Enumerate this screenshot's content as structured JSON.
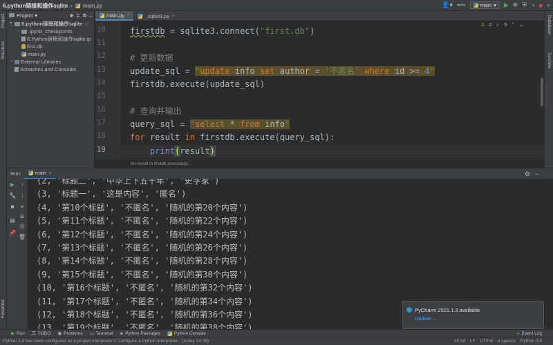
{
  "titlebar": {
    "project": "6.python链接和操作sqlite",
    "file": "main.py",
    "run_config": "main"
  },
  "sidebar_tabs": {
    "project": "Project",
    "structure": "Structure",
    "favorites": "Favorites"
  },
  "right_tabs": {
    "database": "Database",
    "sciview": "SciView"
  },
  "project_panel": {
    "header": "Project",
    "tree": [
      {
        "label": "6.python链接和操作sqlite",
        "suffix": "~/",
        "icon": "folder-icon",
        "indent": 0,
        "arrow": "▾"
      },
      {
        "label": ".ipynb_checkpoints",
        "icon": "folder-icon",
        "indent": 1,
        "arrow": "›"
      },
      {
        "label": "6.Python链接和操作sqlite.ip",
        "icon": "file-icon",
        "indent": 1,
        "arrow": ""
      },
      {
        "label": "first.db",
        "icon": "db-icon",
        "indent": 1,
        "arrow": ""
      },
      {
        "label": "main.py",
        "icon": "python-file-icon",
        "indent": 1,
        "arrow": ""
      },
      {
        "label": "External Libraries",
        "icon": "library-icon",
        "indent": 0,
        "arrow": "›"
      },
      {
        "label": "Scratches and Consoles",
        "icon": "scratch-icon",
        "indent": 0,
        "arrow": ""
      }
    ]
  },
  "editor_tabs": [
    {
      "label": "main.py",
      "active": true
    },
    {
      "label": "_sqlite3.py",
      "active": false
    }
  ],
  "inspection": {
    "warnings": "2",
    "weak": "5"
  },
  "code": {
    "line_numbers": [
      "10",
      "11",
      "12",
      "13",
      "14",
      "15",
      "16",
      "17",
      "18",
      "19"
    ],
    "l10": {
      "a": "firstdb",
      "b": " = sqlite3.connect(",
      "c": "\"first.db\"",
      "d": ")"
    },
    "l12": "# 更新数据",
    "l13": {
      "a": "update_sql = ",
      "q1": "\"",
      "kw1": "update",
      "t1": " info ",
      "kw2": "set",
      "t2": " author = ",
      "s1": "'不匿名'",
      "t3": " ",
      "kw3": "where",
      "t4": " id >= ",
      "n": "4",
      "q2": "\""
    },
    "l14": "firstdb.execute(update_sql)",
    "l16": "# 查询并输出",
    "l17": {
      "a": "query_sql = ",
      "q1": "\"",
      "kw1": "select",
      "t1": " * ",
      "kw2": "from",
      "t2": " info",
      "q2": "\""
    },
    "l18": {
      "kw1": "for",
      "t1": " result ",
      "kw2": "in",
      "t2": " firstdb.execute(query_sql):"
    },
    "l19": {
      "indent": "    ",
      "fn": "print",
      "p1": "(",
      "t": "result",
      "p2": ")"
    }
  },
  "editor_breadcrumb": "for result in firstdb.execute(q...",
  "run": {
    "label": "Run:",
    "tab": "main"
  },
  "console_lines": [
    "(2, '标题二', '中华上下五千年', '史学家')",
    "(3, '标题一', '这是内容', '匿名')",
    "(4, '第10个标题', '不匿名', '随机的第20个内容')",
    "(5, '第11个标题', '不匿名', '随机的第22个内容')",
    "(6, '第12个标题', '不匿名', '随机的第24个内容')",
    "(7, '第13个标题', '不匿名', '随机的第26个内容')",
    "(8, '第14个标题', '不匿名', '随机的第28个内容')",
    "(9, '第15个标题', '不匿名', '随机的第30个内容')",
    "(10, '第16个标题', '不匿名', '随机的第32个内容')",
    "(11, '第17个标题', '不匿名', '随机的第34个内容')",
    "(12, '第18个标题', '不匿名', '随机的第36个内容')",
    "(13, '第19个标题', '不匿名', '随机的第38个内容')"
  ],
  "notification": {
    "title": "PyCharm 2021.1.3 available",
    "link": "Update..."
  },
  "bottom_tabs": [
    "Run",
    "TODO",
    "Problems",
    "Terminal",
    "Python Packages",
    "Python Console"
  ],
  "event_log": "Event Log",
  "status": {
    "message": "Python 3.8 has been configured as a project interpreter // Configure a Python interpreter... (today 14:35)",
    "position": "19:18",
    "line_sep": "LF",
    "encoding": "UTF-8",
    "indent": "4 spaces",
    "interpreter": "Python 3.8"
  },
  "colors": {
    "accent": "#4a88c7",
    "keyword": "#cc7832",
    "string": "#6a8759",
    "comment": "#808080",
    "link": "#589df6"
  }
}
